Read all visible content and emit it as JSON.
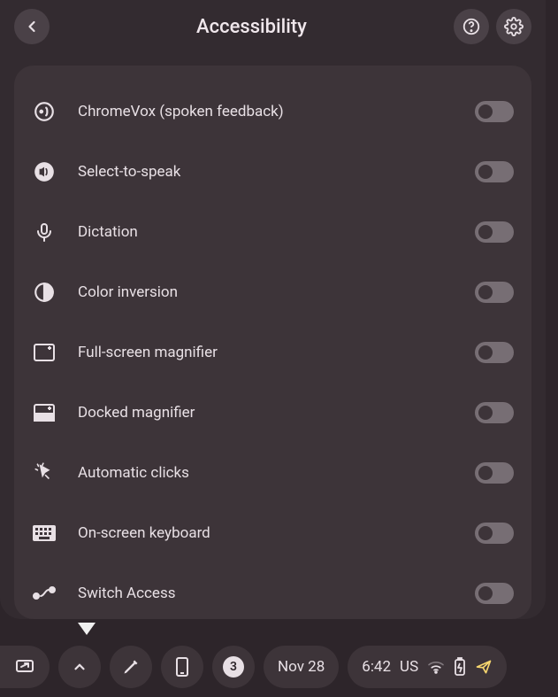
{
  "header": {
    "title": "Accessibility"
  },
  "items": [
    {
      "label": "ChromeVox (spoken feedback)",
      "on": false
    },
    {
      "label": "Select-to-speak",
      "on": false
    },
    {
      "label": "Dictation",
      "on": false
    },
    {
      "label": "Color inversion",
      "on": false
    },
    {
      "label": "Full-screen magnifier",
      "on": false
    },
    {
      "label": "Docked magnifier",
      "on": false
    },
    {
      "label": "Automatic clicks",
      "on": false
    },
    {
      "label": "On-screen keyboard",
      "on": false
    },
    {
      "label": "Switch Access",
      "on": false
    }
  ],
  "taskbar": {
    "notification_count": "3",
    "date": "Nov 28",
    "time": "6:42",
    "ime": "US"
  }
}
